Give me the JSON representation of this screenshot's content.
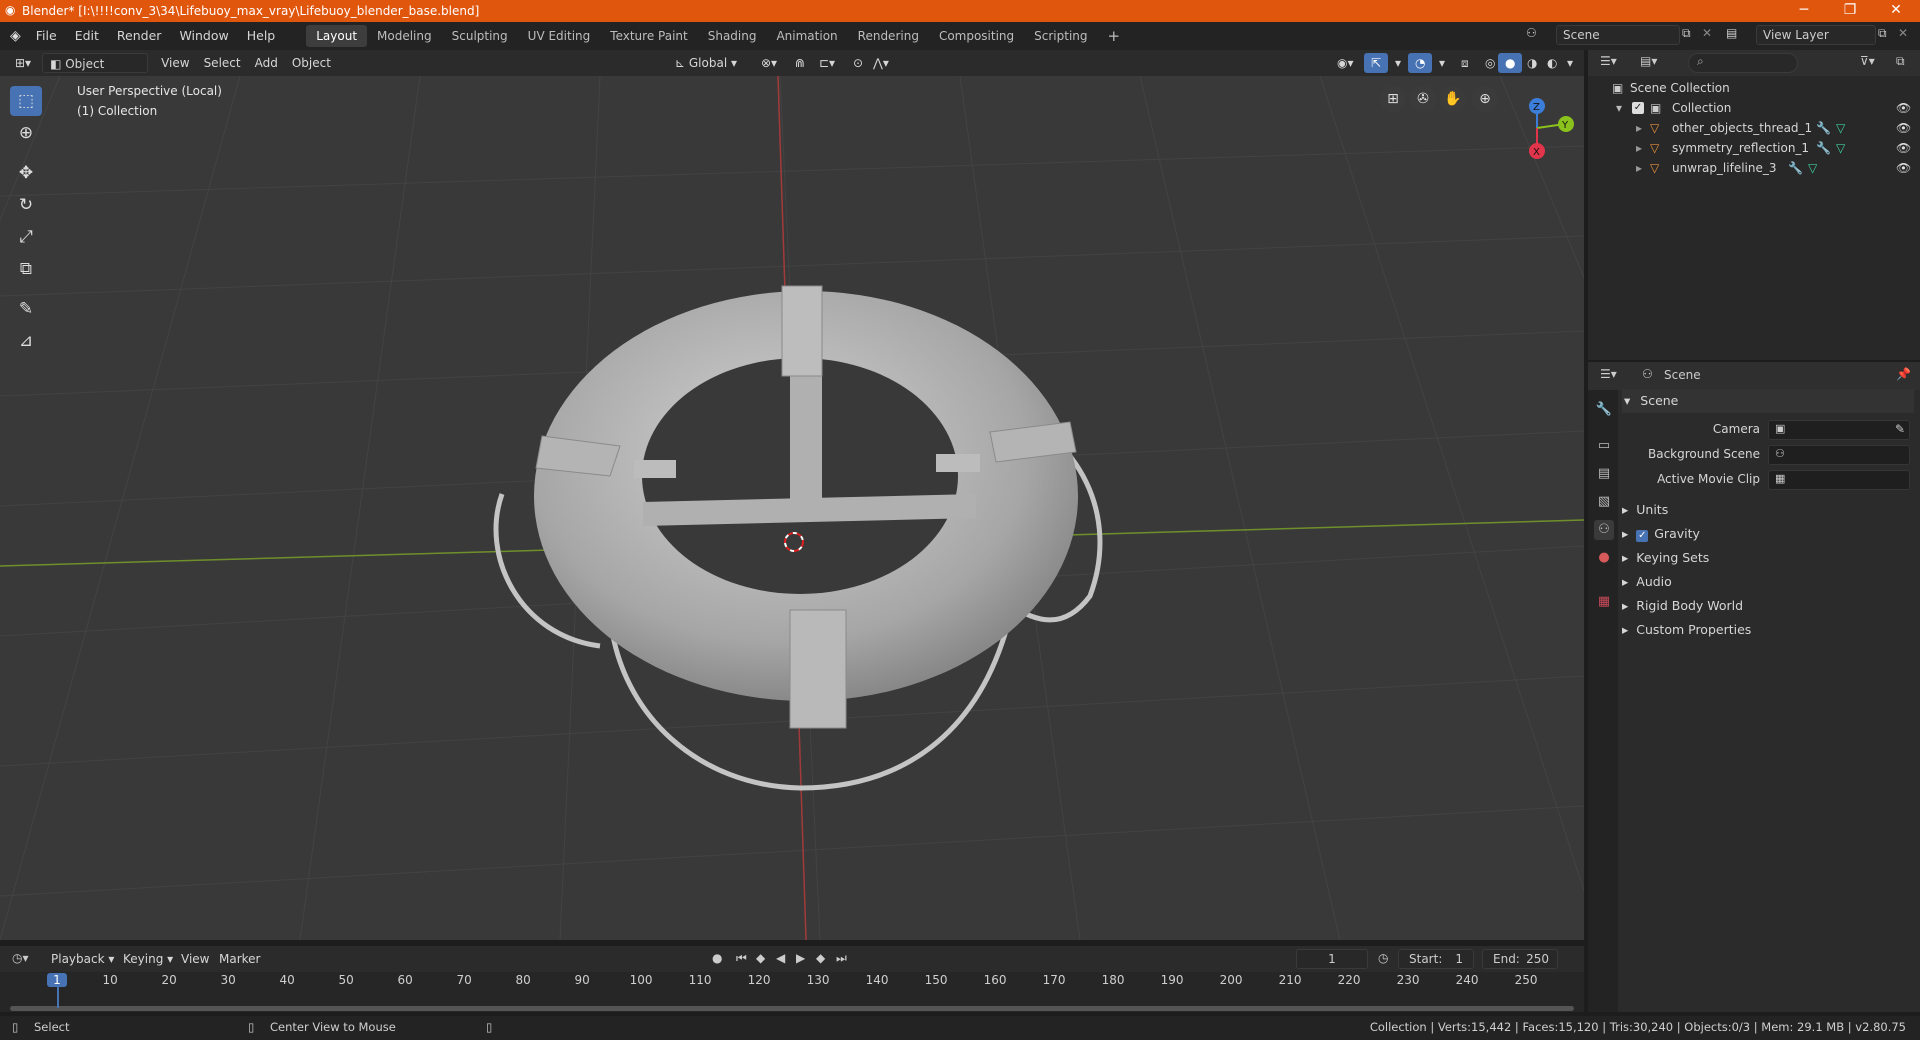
{
  "window": {
    "title": "Blender* [I:\\!!!!conv_3\\34\\Lifebuoy_max_vray\\Lifebuoy_blender_base.blend]",
    "minimize": "─",
    "restore": "❐",
    "close": "✕"
  },
  "menu": {
    "items": [
      "File",
      "Edit",
      "Render",
      "Window",
      "Help"
    ]
  },
  "workspaces": [
    "Layout",
    "Modeling",
    "Sculpting",
    "UV Editing",
    "Texture Paint",
    "Shading",
    "Animation",
    "Rendering",
    "Compositing",
    "Scripting"
  ],
  "workspace_add": "+",
  "scene_field": "Scene",
  "view_layer_field": "View Layer",
  "viewport_header": {
    "mode": "Object Mode",
    "menus": [
      "View",
      "Select",
      "Add",
      "Object"
    ],
    "transform": "Global"
  },
  "overlay": {
    "perspective": "User Perspective (Local)",
    "collection": "(1) Collection"
  },
  "gizmo": {
    "z": "Z",
    "y": "Y",
    "x": "X"
  },
  "outliner": {
    "scene_collection": "Scene Collection",
    "collection": "Collection",
    "objects": [
      "other_objects_thread_1",
      "symmetry_reflection_1",
      "unwrap_lifeline_3"
    ]
  },
  "properties": {
    "context": "Scene",
    "panel": "Scene",
    "camera_label": "Camera",
    "background_scene_label": "Background Scene",
    "active_movie_clip_label": "Active Movie Clip",
    "sections": [
      "Units",
      "Gravity",
      "Keying Sets",
      "Audio",
      "Rigid Body World",
      "Custom Properties"
    ],
    "gravity_checked": true
  },
  "timeline": {
    "menus": [
      "Playback",
      "Keying",
      "View",
      "Marker"
    ],
    "current_frame": "1",
    "start_label": "Start:",
    "start": "1",
    "end_label": "End:",
    "end": "250",
    "ticks": [
      "1",
      "10",
      "20",
      "30",
      "40",
      "50",
      "60",
      "70",
      "80",
      "90",
      "100",
      "110",
      "120",
      "130",
      "140",
      "150",
      "160",
      "170",
      "180",
      "190",
      "200",
      "210",
      "220",
      "230",
      "240",
      "250"
    ]
  },
  "status": {
    "left_action": "Select",
    "middle_action": "Center View to Mouse",
    "stats": "Collection | Verts:15,442 | Faces:15,120 | Tris:30,240 | Objects:0/3 | Mem: 29.1 MB | v2.80.75"
  },
  "colors": {
    "accent": "#4772b3",
    "title_bar": "#e1560d",
    "x_axis": "#e2344a",
    "y_axis": "#8bc11d",
    "z_axis": "#3b7dd8"
  }
}
